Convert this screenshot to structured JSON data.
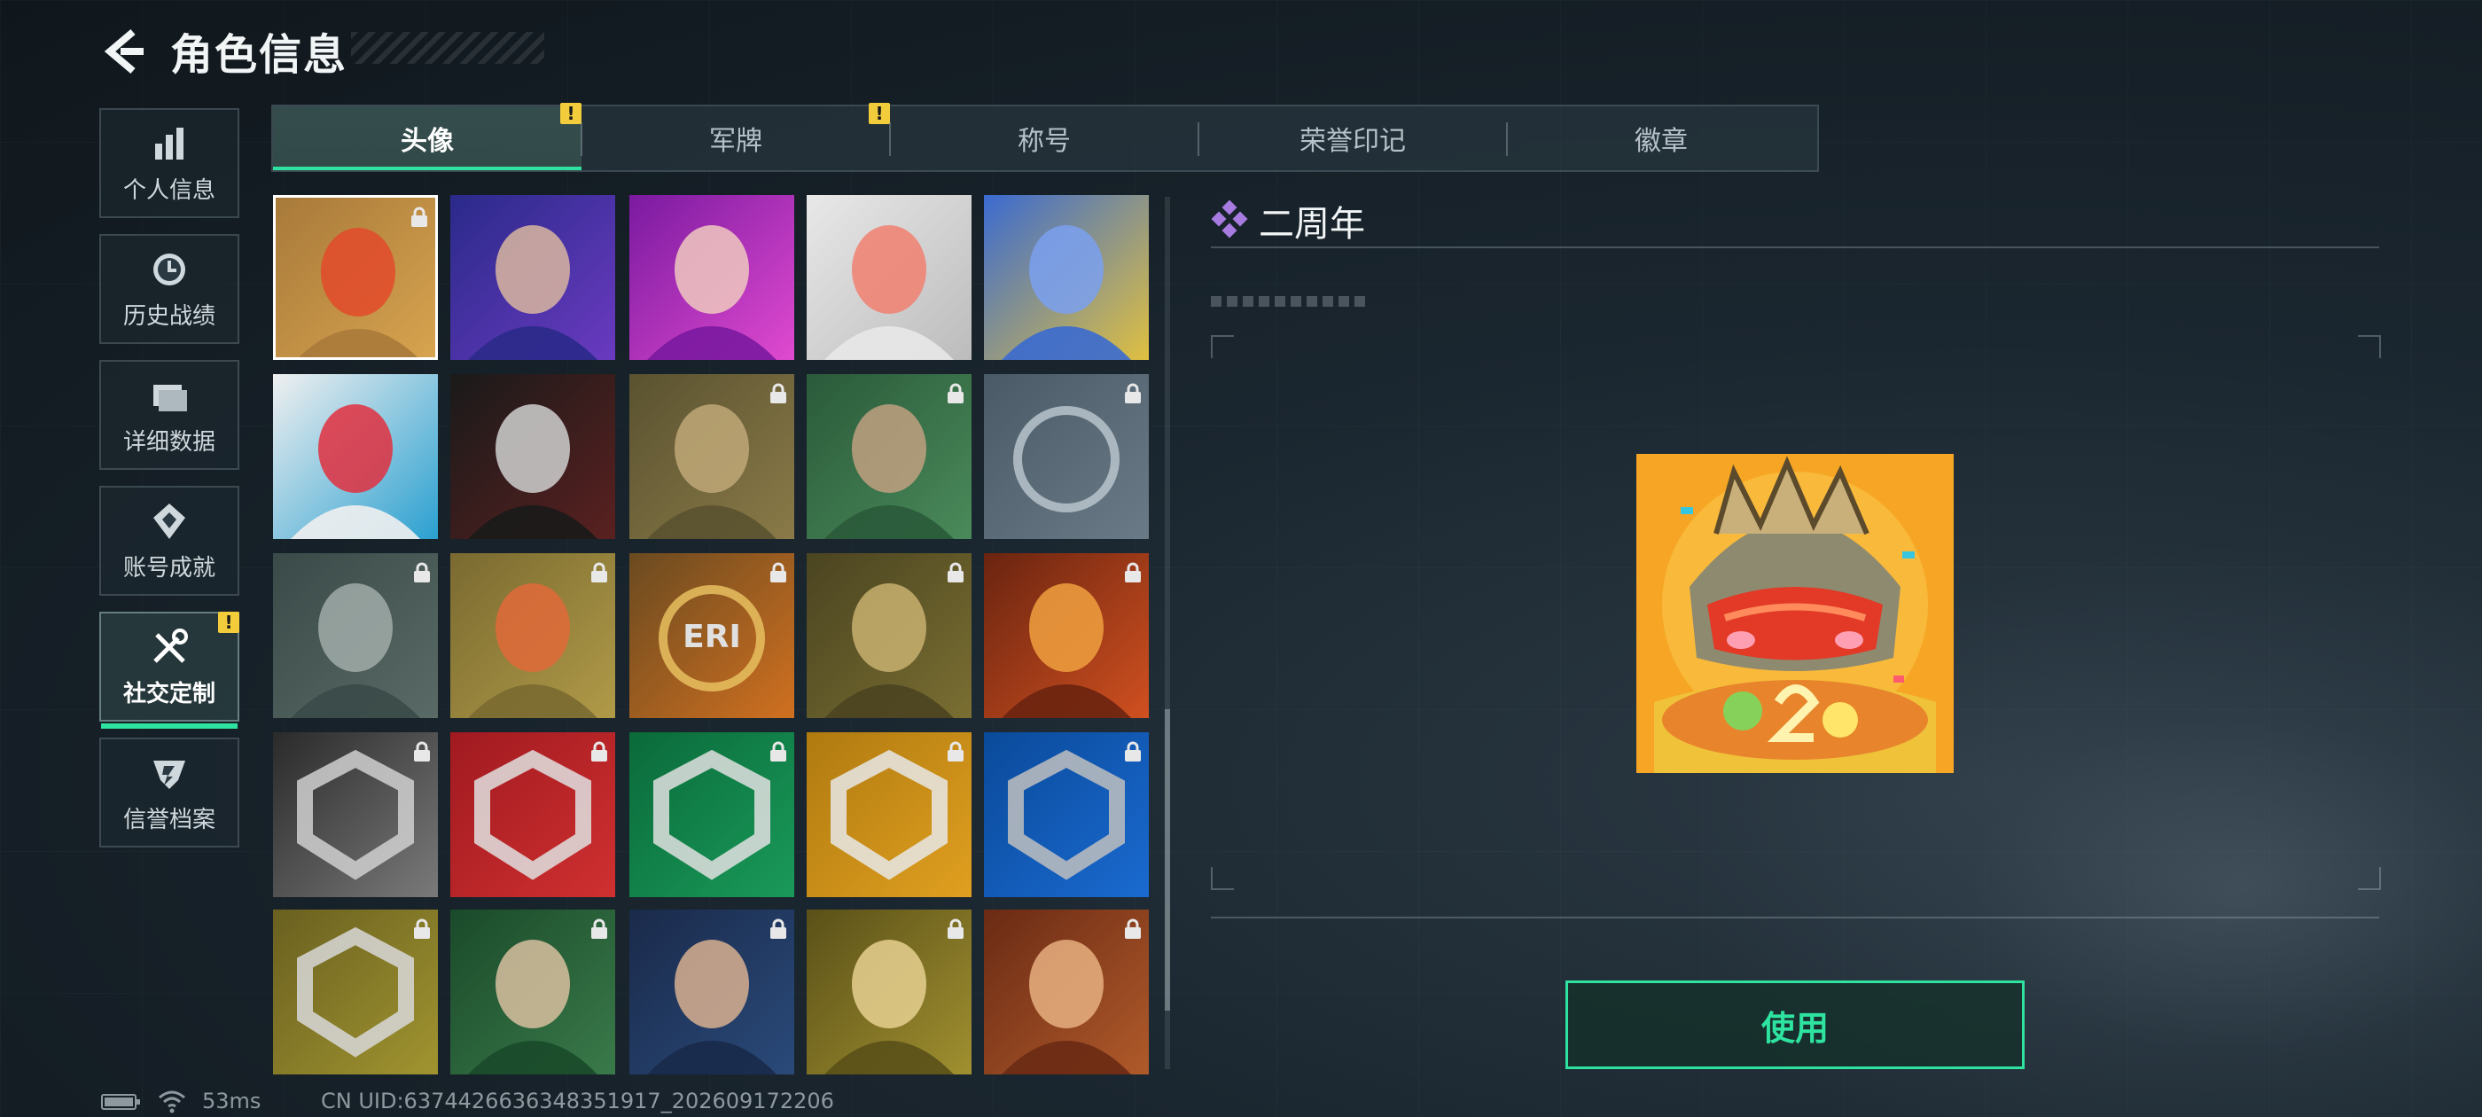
{
  "header": {
    "title": "角色信息"
  },
  "sidebar": {
    "items": [
      {
        "label": "个人信息",
        "icon": "bar-chart-icon"
      },
      {
        "label": "历史战绩",
        "icon": "history-clock-icon"
      },
      {
        "label": "详细数据",
        "icon": "folder-icon"
      },
      {
        "label": "账号成就",
        "icon": "achievement-icon"
      },
      {
        "label": "社交定制",
        "icon": "tools-icon",
        "active": true,
        "alert": "!"
      },
      {
        "label": "信誉档案",
        "icon": "reputation-shield-icon"
      }
    ]
  },
  "tabs": [
    {
      "label": "头像",
      "active": true,
      "alert": "!"
    },
    {
      "label": "军牌",
      "alert": "!"
    },
    {
      "label": "称号"
    },
    {
      "label": "荣誉印记"
    },
    {
      "label": "徽章"
    }
  ],
  "avatars": [
    {
      "id": "twin-anniversary-helmet",
      "selected": true,
      "locked": true
    },
    {
      "id": "man-glasses-purple",
      "locked": false
    },
    {
      "id": "woman-goggles-pink",
      "locked": false
    },
    {
      "id": "chibi-soldier-headset",
      "locked": false
    },
    {
      "id": "golden-helmet-chibi",
      "locked": false
    },
    {
      "id": "red-octopus-wave",
      "locked": false
    },
    {
      "id": "masked-puppet",
      "locked": false
    },
    {
      "id": "bald-soldier-headset",
      "locked": true
    },
    {
      "id": "bearded-operator-headset",
      "locked": true
    },
    {
      "id": "star-gear-emblem",
      "locked": true
    },
    {
      "id": "helicopter-landscape",
      "locked": true
    },
    {
      "id": "helmet-chibi-noodles",
      "locked": true
    },
    {
      "id": "eri-globe-emblem",
      "locked": true,
      "text": "ERI"
    },
    {
      "id": "glasses-soldier",
      "locked": true
    },
    {
      "id": "explosion-scene",
      "locked": true
    },
    {
      "id": "pistol-soldier",
      "locked": true
    },
    {
      "id": "red-shield-emblem",
      "locked": true
    },
    {
      "id": "green-cross-emblem",
      "locked": true
    },
    {
      "id": "orange-arrow-emblem",
      "locked": true
    },
    {
      "id": "blue-hexagon-emblem",
      "locked": true
    },
    {
      "id": "yellow-diamond-emblem",
      "locked": true
    },
    {
      "id": "green-female-operator",
      "locked": true
    },
    {
      "id": "blue-male-operator",
      "locked": true
    },
    {
      "id": "yellow-blonde-operator",
      "locked": true
    },
    {
      "id": "red-haired-operator",
      "locked": true
    }
  ],
  "detail": {
    "title": "二周年",
    "use_label": "使用"
  },
  "status": {
    "ping": "53ms",
    "uid": "CN UID:6374426636348351917_202609172206"
  },
  "colors": {
    "accent": "#2ee3a0",
    "alert": "#f2cc3a",
    "diamond": "#a77be0"
  }
}
